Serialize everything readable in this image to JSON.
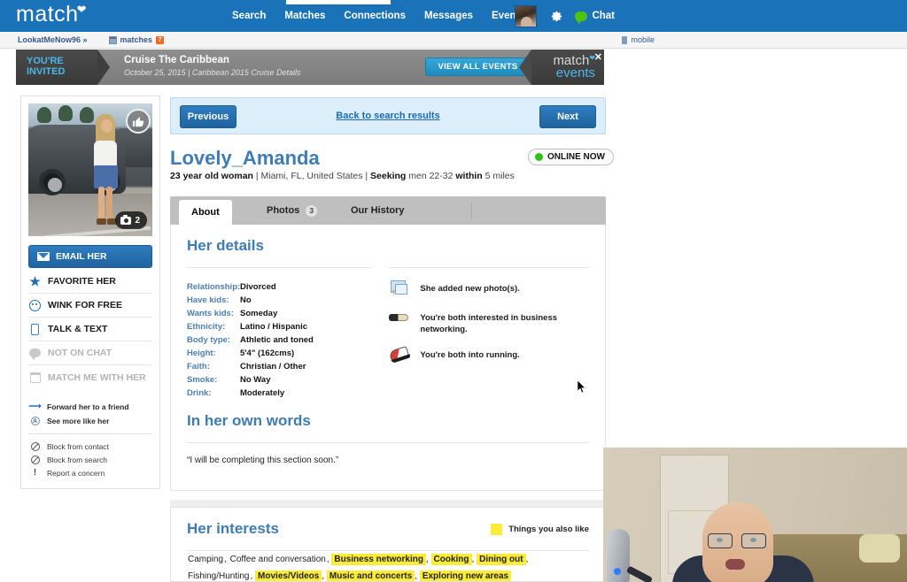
{
  "topnav": {
    "brand": "match",
    "items": [
      "Search",
      "Matches",
      "Connections",
      "Messages",
      "Events"
    ],
    "chat_label": "Chat"
  },
  "breadcrumb": {
    "username": "LookatMeNow96 »",
    "matches_label": "matches",
    "matches_count": "7",
    "mobile_label": "mobile"
  },
  "event_banner": {
    "invited_line1": "YOU'RE",
    "invited_line2": "INVITED",
    "title": "Cruise The Caribbean",
    "subtitle": "October 25, 2015 | Caribbean 2015 Cruise Details",
    "button": "VIEW ALL EVENTS",
    "logo_line1": "match",
    "logo_line2": "events",
    "close": "✕"
  },
  "sidebar": {
    "photo_count": "2",
    "email_button": "EMAIL HER",
    "actions": [
      {
        "label": "FAVORITE HER",
        "icon": "star-icon",
        "disabled": false
      },
      {
        "label": "WINK FOR FREE",
        "icon": "wink-icon",
        "disabled": false
      },
      {
        "label": "TALK & TEXT",
        "icon": "phone-icon",
        "disabled": false
      },
      {
        "label": "NOT ON CHAT",
        "icon": "chat-icon",
        "disabled": true
      },
      {
        "label": "MATCH ME WITH HER",
        "icon": "calendar-icon",
        "disabled": true
      }
    ],
    "links": [
      {
        "label": "Forward her to a friend",
        "icon": "forward-arrow-icon"
      },
      {
        "label": "See more like her",
        "icon": "circle-a-icon"
      }
    ],
    "report_links": [
      {
        "label": "Block from contact",
        "icon": "block-icon"
      },
      {
        "label": "Block from search",
        "icon": "block-icon"
      },
      {
        "label": "Report a concern",
        "icon": "exclamation-icon"
      }
    ]
  },
  "profile_nav": {
    "previous": "Previous",
    "back": "Back to search results",
    "next": "Next"
  },
  "profile": {
    "name": "Lovely_Amanda",
    "status": "ONLINE NOW",
    "age_line_age": "23 year old woman",
    "age_line_location": " | Miami, FL, United States | ",
    "seeking_label": "Seeking",
    "seeking_value": " men 22-32 ",
    "within_label": "within",
    "within_value": " 5 miles"
  },
  "tabs": [
    {
      "label": "About",
      "count": "",
      "active": true
    },
    {
      "label": "Photos",
      "count": "3",
      "active": false
    },
    {
      "label": "Our History",
      "count": "",
      "active": false
    }
  ],
  "her_details": {
    "title": "Her details",
    "rows": [
      {
        "label": "Relationship:",
        "value": "Divorced"
      },
      {
        "label": "Have kids:",
        "value": "No"
      },
      {
        "label": "Wants kids:",
        "value": "Someday"
      },
      {
        "label": "Ethnicity:",
        "value": "Latino / Hispanic"
      },
      {
        "label": "Body type:",
        "value": "Athletic and toned"
      },
      {
        "label": "Height:",
        "value": "5'4\" (162cms)"
      },
      {
        "label": "Faith:",
        "value": "Christian / Other"
      },
      {
        "label": "Smoke:",
        "value": "No Way"
      },
      {
        "label": "Drink:",
        "value": "Moderately"
      }
    ],
    "activities": [
      {
        "icon": "new-photo-icon",
        "text": "She added new photo(s)."
      },
      {
        "icon": "handshake-icon",
        "text": "You're both interested in business networking."
      },
      {
        "icon": "running-shoe-icon",
        "text": "You're both into running."
      }
    ]
  },
  "own_words": {
    "title": "In her own words",
    "quote": "“I will be completing this section soon.”"
  },
  "her_interests": {
    "title": "Her interests",
    "legend": "Things you also like",
    "items": [
      {
        "label": "Camping",
        "highlighted": false
      },
      {
        "label": "Coffee and conversation",
        "highlighted": false
      },
      {
        "label": "Business networking",
        "highlighted": true
      },
      {
        "label": "Cooking",
        "highlighted": true
      },
      {
        "label": "Dining out",
        "highlighted": true
      },
      {
        "label": "Fishing/Hunting",
        "highlighted": false
      },
      {
        "label": "Movies/Videos",
        "highlighted": true
      },
      {
        "label": "Music and concerts",
        "highlighted": true
      },
      {
        "label": "Exploring new areas",
        "highlighted": true
      }
    ]
  },
  "colors": {
    "nav_blue": "#1a72b8",
    "accent_blue": "#3d7cb5",
    "link_blue": "#1a6bb0",
    "online_green": "#2ec413",
    "highlight_yellow": "#fbec35",
    "badge_orange": "#f26b21",
    "event_cyan": "#49b7e8"
  }
}
